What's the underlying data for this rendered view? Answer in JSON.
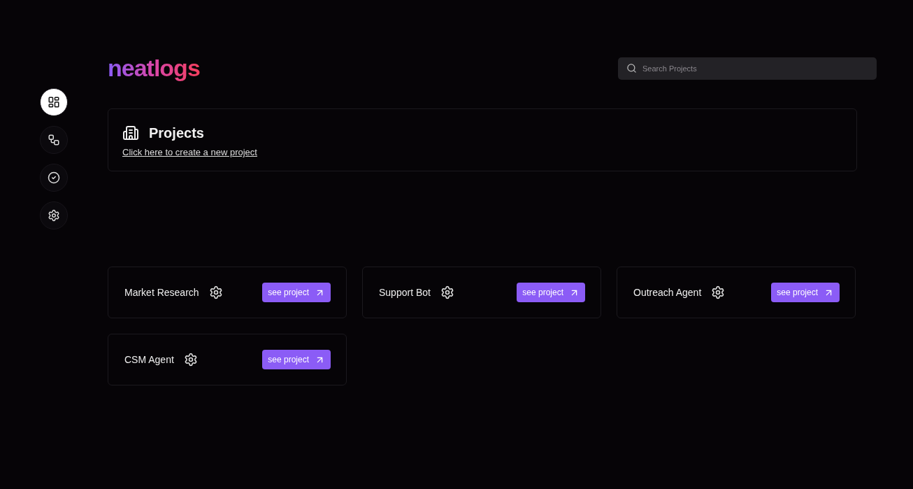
{
  "logo": {
    "text": "neatlogs"
  },
  "sidebar": {
    "items": [
      {
        "kind": "dashboard",
        "selected": true
      },
      {
        "kind": "workflow",
        "selected": false
      },
      {
        "kind": "check",
        "selected": false
      },
      {
        "kind": "settings",
        "selected": false
      }
    ]
  },
  "search": {
    "placeholder": "Search Projects"
  },
  "header": {
    "title": "Projects",
    "link": "Click here to create a new project"
  },
  "projects": [
    {
      "name": "Market Research",
      "button": "see project"
    },
    {
      "name": "Support Bot",
      "button": "see project"
    },
    {
      "name": "Outreach Agent",
      "button": "see project"
    },
    {
      "name": "CSM Agent",
      "button": "see project"
    }
  ]
}
